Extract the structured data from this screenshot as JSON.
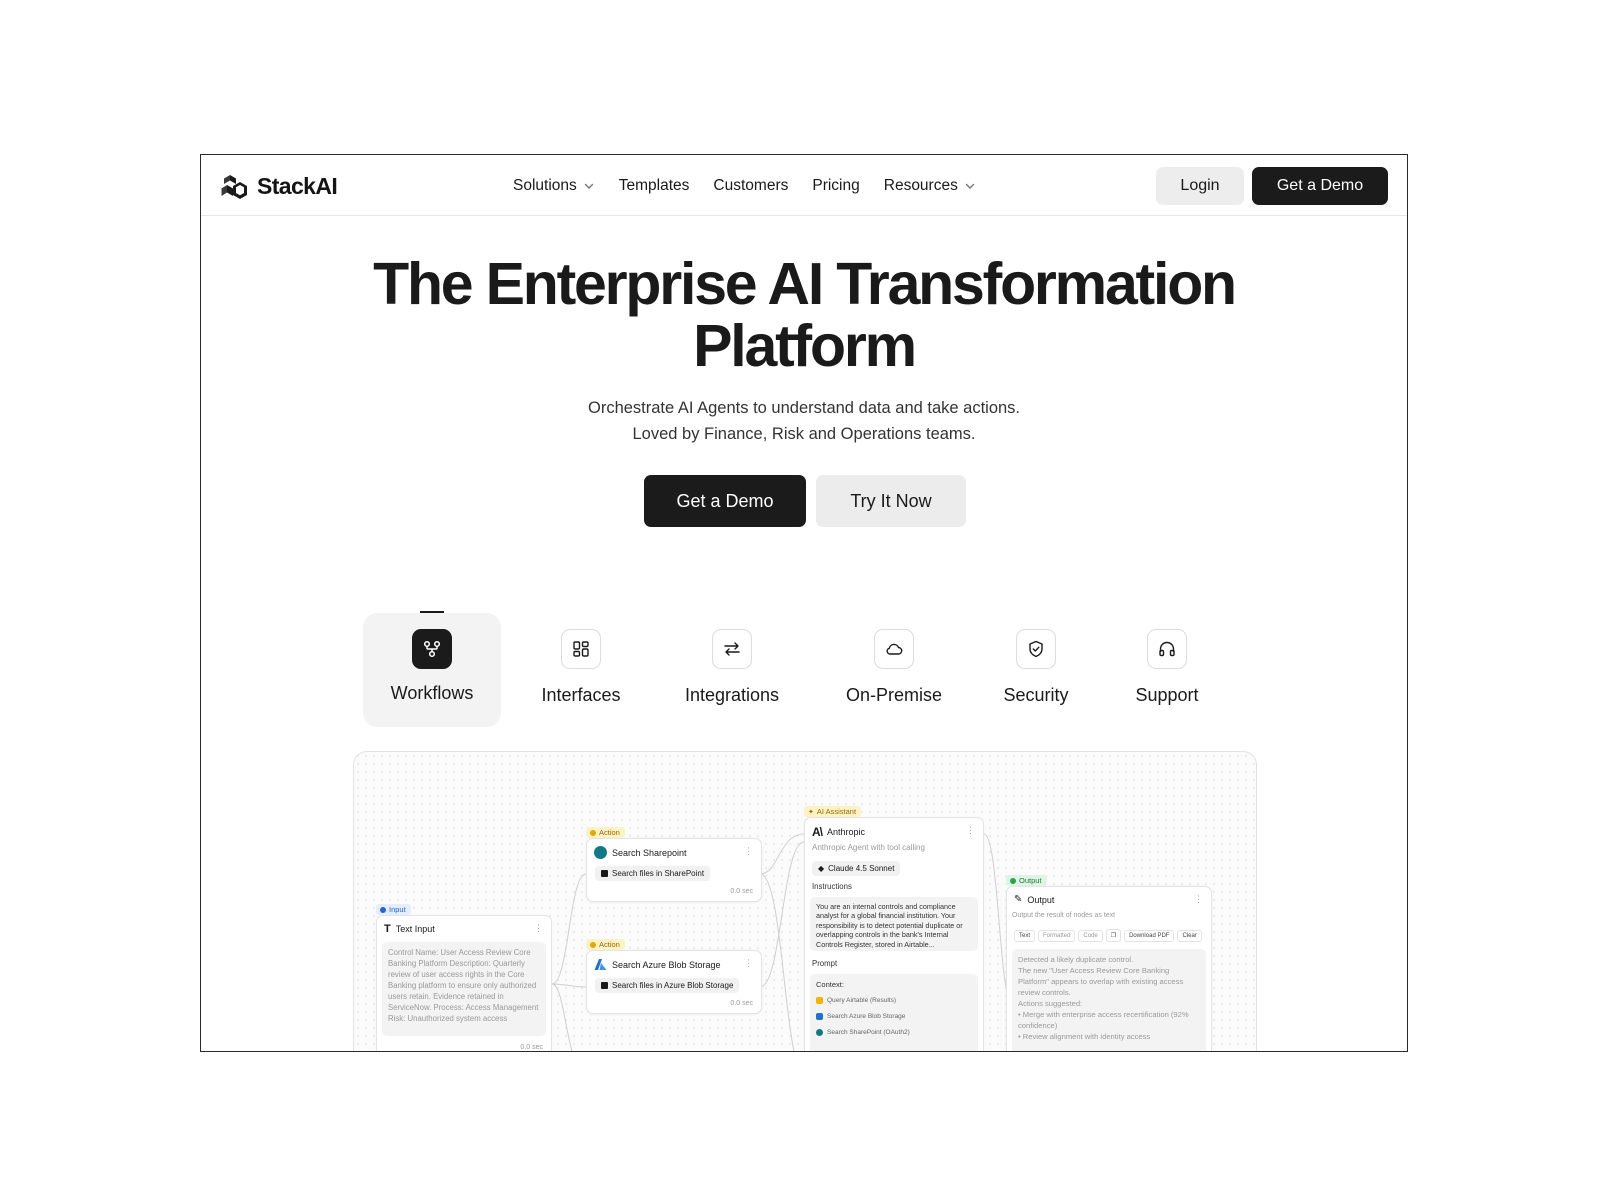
{
  "brand": {
    "name": "StackAI"
  },
  "nav": {
    "links": [
      {
        "label": "Solutions",
        "has_dropdown": true
      },
      {
        "label": "Templates",
        "has_dropdown": false
      },
      {
        "label": "Customers",
        "has_dropdown": false
      },
      {
        "label": "Pricing",
        "has_dropdown": false
      },
      {
        "label": "Resources",
        "has_dropdown": true
      }
    ],
    "login": "Login",
    "demo": "Get a Demo"
  },
  "hero": {
    "title_line1": "The Enterprise AI Transformation",
    "title_line2": "Platform",
    "sub_line1": "Orchestrate AI Agents to understand data and take actions.",
    "sub_line2": "Loved by Finance, Risk and Operations teams.",
    "cta_primary": "Get a Demo",
    "cta_secondary": "Try It Now"
  },
  "tabs": [
    {
      "label": "Workflows",
      "icon": "workflow-icon",
      "active": true
    },
    {
      "label": "Interfaces",
      "icon": "grid-icon",
      "active": false
    },
    {
      "label": "Integrations",
      "icon": "arrows-swap-icon",
      "active": false
    },
    {
      "label": "On-Premise",
      "icon": "cloud-icon",
      "active": false
    },
    {
      "label": "Security",
      "icon": "shield-check-icon",
      "active": false
    },
    {
      "label": "Support",
      "icon": "headphones-icon",
      "active": false
    }
  ],
  "canvas": {
    "input_node": {
      "badge": "Input",
      "title": "Text Input",
      "body": "Control Name: User Access Review Core Banking Platform Description: Quarterly review of user access rights in the Core Banking platform to ensure only authorized users retain. Evidence retained in ServiceNow. Process: Access Management Risk: Unauthorized system access",
      "time": "0.0 sec"
    },
    "sharepoint_node": {
      "badge": "Action",
      "title": "Search Sharepoint",
      "pill": "Search files in SharePoint",
      "time": "0.0 sec"
    },
    "azure_node": {
      "badge": "Action",
      "title": "Search Azure Blob Storage",
      "pill": "Search files in Azure Blob Storage",
      "time": "0.0 sec"
    },
    "ai_node": {
      "badge": "AI Assistant",
      "title": "Anthropic",
      "subtitle": "Anthropic Agent with tool calling",
      "model": "Claude 4.5 Sonnet",
      "instructions_label": "Instructions",
      "instructions": "You are an internal controls and compliance analyst for a global financial institution. Your responsibility is to detect potential duplicate or overlapping controls in the bank's Internal Controls Register, stored in Airtable...",
      "prompt_label": "Prompt",
      "context_label": "Context:",
      "context_items": [
        "Query Airtable (Results)",
        "Search Azure Blob Storage",
        "Search SharePoint (OAuth2)"
      ]
    },
    "output_node": {
      "badge": "Output",
      "title": "Output",
      "subtitle": "Output the result of nodes as text",
      "tools": [
        "Text",
        "Formatted",
        "Code",
        "Download PDF",
        "Clear"
      ],
      "line1": "Detected a likely duplicate control.",
      "line2": "The new \"User Access Review Core Banking Platform\" appears to overlap with existing access review controls.",
      "line3": "Actions suggested:",
      "line4": "• Merge with enterprise access recertification (92% confidence)",
      "line5": "• Review alignment with identity access"
    }
  }
}
